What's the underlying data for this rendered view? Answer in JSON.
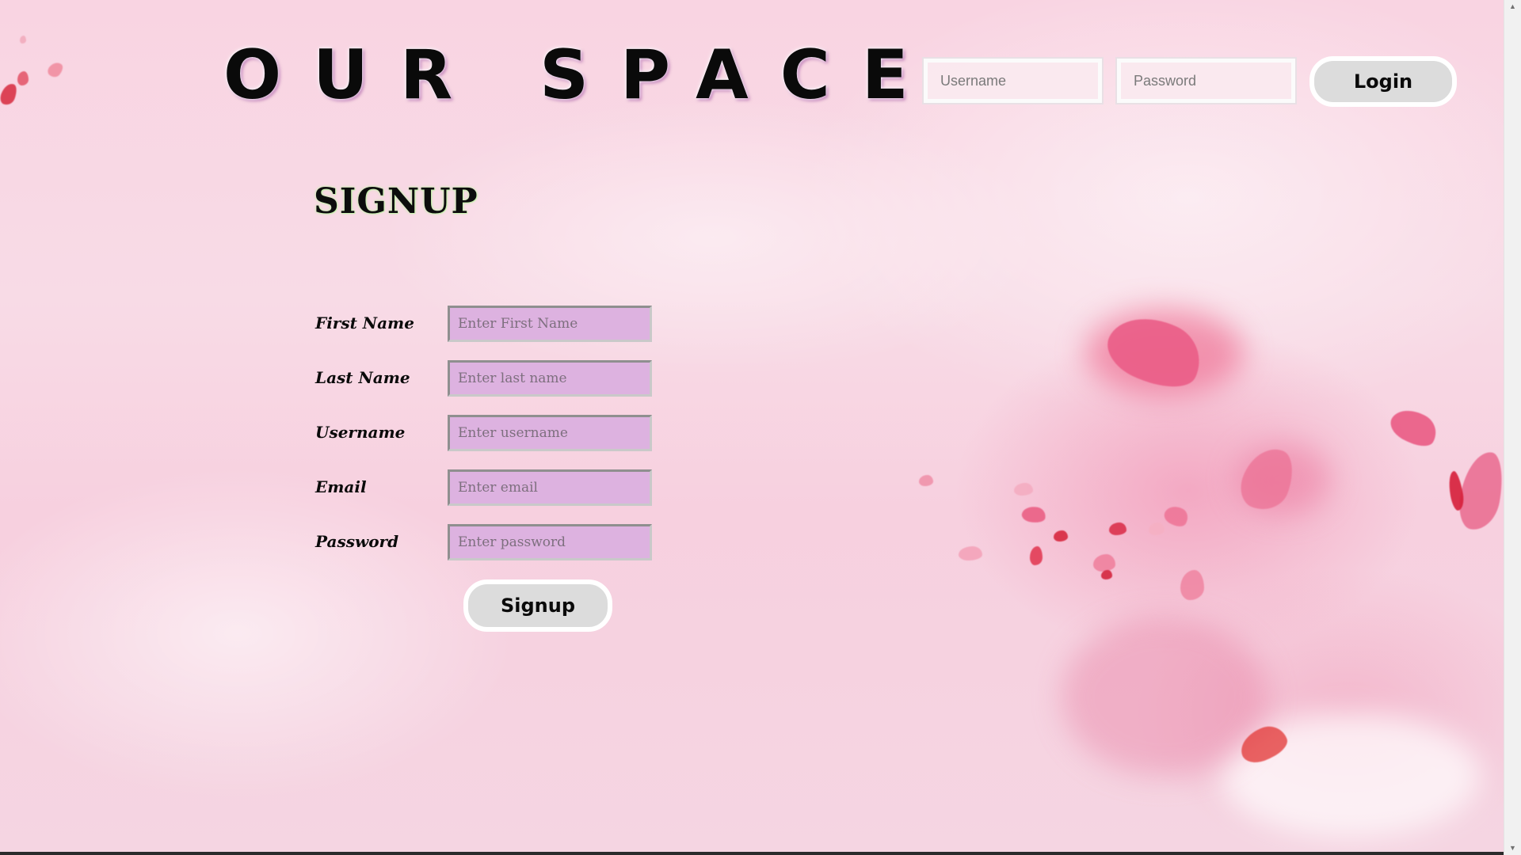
{
  "header": {
    "site_title": "OUR SPACE",
    "login": {
      "username_placeholder": "Username",
      "password_placeholder": "Password",
      "login_label": "Login"
    }
  },
  "signup_form": {
    "title": "SIGNUP",
    "fields": [
      {
        "label": "First Name",
        "placeholder": "Enter First Name"
      },
      {
        "label": "Last Name",
        "placeholder": "Enter last name"
      },
      {
        "label": "Username",
        "placeholder": "Enter username"
      },
      {
        "label": "Email",
        "placeholder": "Enter email"
      },
      {
        "label": "Password",
        "placeholder": "Enter password"
      }
    ],
    "submit_label": "Signup"
  },
  "colors": {
    "background": "#f8d6e3",
    "input_fill": "#ddb2e0",
    "button_fill": "#dcdcdc",
    "title_glow": "#c8f0b0",
    "petal": "#e8527a"
  }
}
